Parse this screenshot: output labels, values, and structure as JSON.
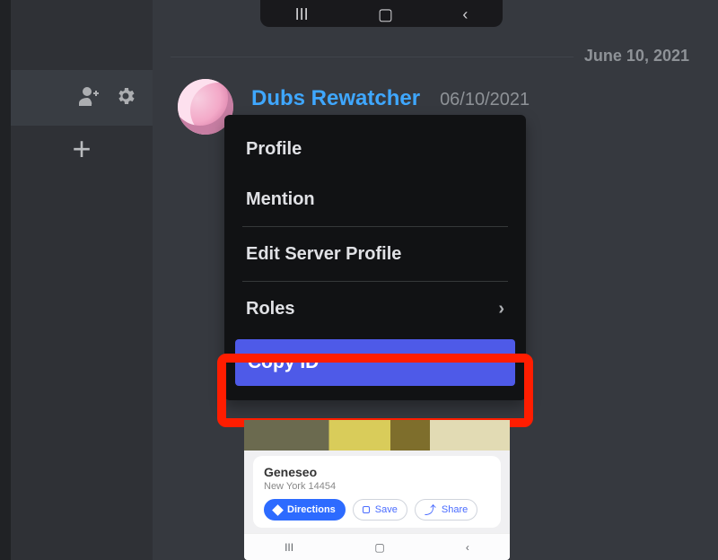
{
  "divider_date": "June 10, 2021",
  "message": {
    "username": "Dubs Rewatcher",
    "timestamp": "06/10/2021"
  },
  "context_menu": {
    "profile": "Profile",
    "mention": "Mention",
    "edit": "Edit Server Profile",
    "roles": "Roles",
    "copy_id": "Copy ID"
  },
  "maps_card": {
    "title": "Geneseo",
    "subtitle": "New York 14454",
    "directions": "Directions",
    "save": "Save",
    "share": "Share"
  },
  "nav_glyphs": {
    "recents": "III",
    "home": "▢",
    "back": "‹"
  }
}
